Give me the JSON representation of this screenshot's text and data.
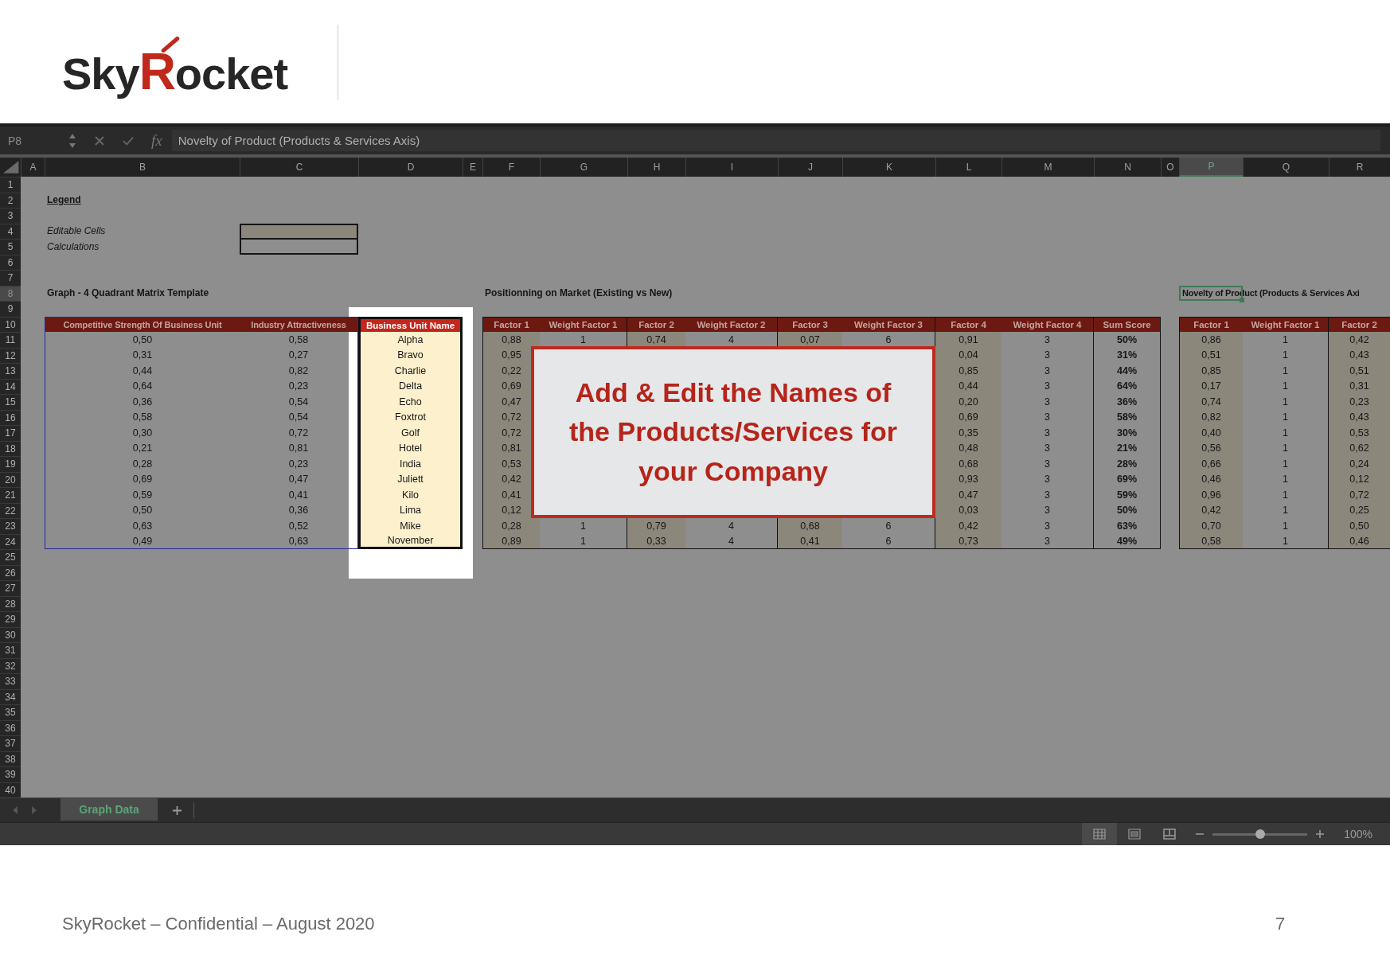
{
  "logo": {
    "lead": "Sky",
    "accent": "R",
    "rest": "ocket"
  },
  "formula_bar": {
    "cell_ref": "P8",
    "fx": "fx",
    "formula": "Novelty of Product (Products & Services Axis)"
  },
  "column_headers": [
    {
      "label": "A",
      "selected": false
    },
    {
      "label": "B",
      "selected": false
    },
    {
      "label": "C",
      "selected": false
    },
    {
      "label": "D",
      "selected": false
    },
    {
      "label": "E",
      "selected": false
    },
    {
      "label": "F",
      "selected": false
    },
    {
      "label": "G",
      "selected": false
    },
    {
      "label": "H",
      "selected": false
    },
    {
      "label": "I",
      "selected": false
    },
    {
      "label": "J",
      "selected": false
    },
    {
      "label": "K",
      "selected": false
    },
    {
      "label": "L",
      "selected": false
    },
    {
      "label": "M",
      "selected": false
    },
    {
      "label": "N",
      "selected": false
    },
    {
      "label": "O",
      "selected": false
    },
    {
      "label": "P",
      "selected": true
    },
    {
      "label": "Q",
      "selected": false
    },
    {
      "label": "R",
      "selected": false
    }
  ],
  "row_headers": [
    {
      "label": "1",
      "selected": false
    },
    {
      "label": "2",
      "selected": false
    },
    {
      "label": "3",
      "selected": false
    },
    {
      "label": "4",
      "selected": false
    },
    {
      "label": "5",
      "selected": false
    },
    {
      "label": "6",
      "selected": false
    },
    {
      "label": "7",
      "selected": false
    },
    {
      "label": "8",
      "selected": true
    },
    {
      "label": "9",
      "selected": false
    },
    {
      "label": "10",
      "selected": false
    },
    {
      "label": "11",
      "selected": false
    },
    {
      "label": "12",
      "selected": false
    },
    {
      "label": "13",
      "selected": false
    },
    {
      "label": "14",
      "selected": false
    },
    {
      "label": "15",
      "selected": false
    },
    {
      "label": "16",
      "selected": false
    },
    {
      "label": "17",
      "selected": false
    },
    {
      "label": "18",
      "selected": false
    },
    {
      "label": "19",
      "selected": false
    },
    {
      "label": "20",
      "selected": false
    },
    {
      "label": "21",
      "selected": false
    },
    {
      "label": "22",
      "selected": false
    },
    {
      "label": "23",
      "selected": false
    },
    {
      "label": "24",
      "selected": false
    },
    {
      "label": "25",
      "selected": false
    },
    {
      "label": "26",
      "selected": false
    },
    {
      "label": "27",
      "selected": false
    },
    {
      "label": "28",
      "selected": false
    },
    {
      "label": "29",
      "selected": false
    },
    {
      "label": "30",
      "selected": false
    },
    {
      "label": "31",
      "selected": false
    },
    {
      "label": "32",
      "selected": false
    },
    {
      "label": "33",
      "selected": false
    },
    {
      "label": "34",
      "selected": false
    },
    {
      "label": "35",
      "selected": false
    },
    {
      "label": "36",
      "selected": false
    },
    {
      "label": "37",
      "selected": false
    },
    {
      "label": "38",
      "selected": false
    },
    {
      "label": "39",
      "selected": false
    },
    {
      "label": "40",
      "selected": false
    }
  ],
  "legend": {
    "title": "Legend",
    "items": [
      {
        "label": "Editable Cells",
        "kind": "editable"
      },
      {
        "label": "Calculations",
        "kind": "calculation"
      }
    ]
  },
  "matrix_table": {
    "title": "Graph - 4 Quadrant Matrix Template",
    "columns": [
      "Competitive Strength Of Business Unit",
      "Industry Attractiveness"
    ],
    "rows": [
      [
        "0,50",
        "0,58"
      ],
      [
        "0,31",
        "0,27"
      ],
      [
        "0,44",
        "0,82"
      ],
      [
        "0,64",
        "0,23"
      ],
      [
        "0,36",
        "0,54"
      ],
      [
        "0,58",
        "0,54"
      ],
      [
        "0,30",
        "0,72"
      ],
      [
        "0,21",
        "0,81"
      ],
      [
        "0,28",
        "0,23"
      ],
      [
        "0,69",
        "0,47"
      ],
      [
        "0,59",
        "0,41"
      ],
      [
        "0,50",
        "0,36"
      ],
      [
        "0,63",
        "0,52"
      ],
      [
        "0,49",
        "0,63"
      ]
    ]
  },
  "name_column": {
    "header": "Business Unit Name",
    "names": [
      "Alpha",
      "Bravo",
      "Charlie",
      "Delta",
      "Echo",
      "Foxtrot",
      "Golf",
      "Hotel",
      "India",
      "Juliett",
      "Kilo",
      "Lima",
      "Mike",
      "November"
    ]
  },
  "market_table": {
    "title": "Positionning on Market (Existing vs New)",
    "columns": [
      {
        "label": "Factor 1",
        "kind": "factor"
      },
      {
        "label": "Weight Factor 1",
        "kind": "weight"
      },
      {
        "label": "Factor 2",
        "kind": "factor"
      },
      {
        "label": "Weight Factor 2",
        "kind": "weight"
      },
      {
        "label": "Factor 3",
        "kind": "factor"
      },
      {
        "label": "Weight Factor 3",
        "kind": "weight"
      },
      {
        "label": "Factor 4",
        "kind": "factor"
      },
      {
        "label": "Weight Factor 4",
        "kind": "weight"
      },
      {
        "label": "Sum Score",
        "kind": "score"
      }
    ],
    "rows": [
      [
        "0,88",
        "1",
        "0,74",
        "4",
        "0,07",
        "6",
        "0,91",
        "3",
        "50%"
      ],
      [
        "0,95",
        null,
        null,
        null,
        null,
        null,
        "0,04",
        "3",
        "31%"
      ],
      [
        "0,22",
        null,
        null,
        null,
        null,
        null,
        "0,85",
        "3",
        "44%"
      ],
      [
        "0,69",
        null,
        null,
        null,
        null,
        null,
        "0,44",
        "3",
        "64%"
      ],
      [
        "0,47",
        null,
        null,
        null,
        null,
        null,
        "0,20",
        "3",
        "36%"
      ],
      [
        "0,72",
        null,
        null,
        null,
        null,
        null,
        "0,69",
        "3",
        "58%"
      ],
      [
        "0,72",
        null,
        null,
        null,
        null,
        null,
        "0,35",
        "3",
        "30%"
      ],
      [
        "0,81",
        null,
        null,
        null,
        null,
        null,
        "0,48",
        "3",
        "21%"
      ],
      [
        "0,53",
        null,
        null,
        null,
        null,
        null,
        "0,68",
        "3",
        "28%"
      ],
      [
        "0,42",
        null,
        null,
        null,
        null,
        null,
        "0,93",
        "3",
        "69%"
      ],
      [
        "0,41",
        null,
        null,
        null,
        null,
        null,
        "0,47",
        "3",
        "59%"
      ],
      [
        "0,12",
        null,
        null,
        null,
        null,
        null,
        "0,03",
        "3",
        "50%"
      ],
      [
        "0,28",
        "1",
        "0,79",
        "4",
        "0,68",
        "6",
        "0,42",
        "3",
        "63%"
      ],
      [
        "0,89",
        "1",
        "0,33",
        "4",
        "0,41",
        "6",
        "0,73",
        "3",
        "49%"
      ]
    ]
  },
  "novelty_table": {
    "title": "Novelty of Product (Products & Services Axi",
    "title_selected": true,
    "columns": [
      {
        "label": "Factor 1",
        "kind": "factor"
      },
      {
        "label": "Weight Factor 1",
        "kind": "weight"
      },
      {
        "label": "Factor 2",
        "kind": "factor"
      }
    ],
    "rows": [
      [
        "0,86",
        "1",
        "0,42"
      ],
      [
        "0,51",
        "1",
        "0,43"
      ],
      [
        "0,85",
        "1",
        "0,51"
      ],
      [
        "0,17",
        "1",
        "0,31"
      ],
      [
        "0,74",
        "1",
        "0,23"
      ],
      [
        "0,82",
        "1",
        "0,43"
      ],
      [
        "0,40",
        "1",
        "0,53"
      ],
      [
        "0,56",
        "1",
        "0,62"
      ],
      [
        "0,66",
        "1",
        "0,24"
      ],
      [
        "0,46",
        "1",
        "0,12"
      ],
      [
        "0,96",
        "1",
        "0,72"
      ],
      [
        "0,42",
        "1",
        "0,25"
      ],
      [
        "0,70",
        "1",
        "0,50"
      ],
      [
        "0,58",
        "1",
        "0,46"
      ]
    ]
  },
  "callout": {
    "text": "Add & Edit the Names of the Products/Services for your Company"
  },
  "sheet_tabs": [
    {
      "label": "Graph Data",
      "selected": true
    }
  ],
  "status_bar": {
    "zoom": {
      "level": 0.5
    },
    "zoom_label": "100%"
  },
  "footer": {
    "text": "SkyRocket – Confidential – August 2020",
    "page": "7"
  }
}
